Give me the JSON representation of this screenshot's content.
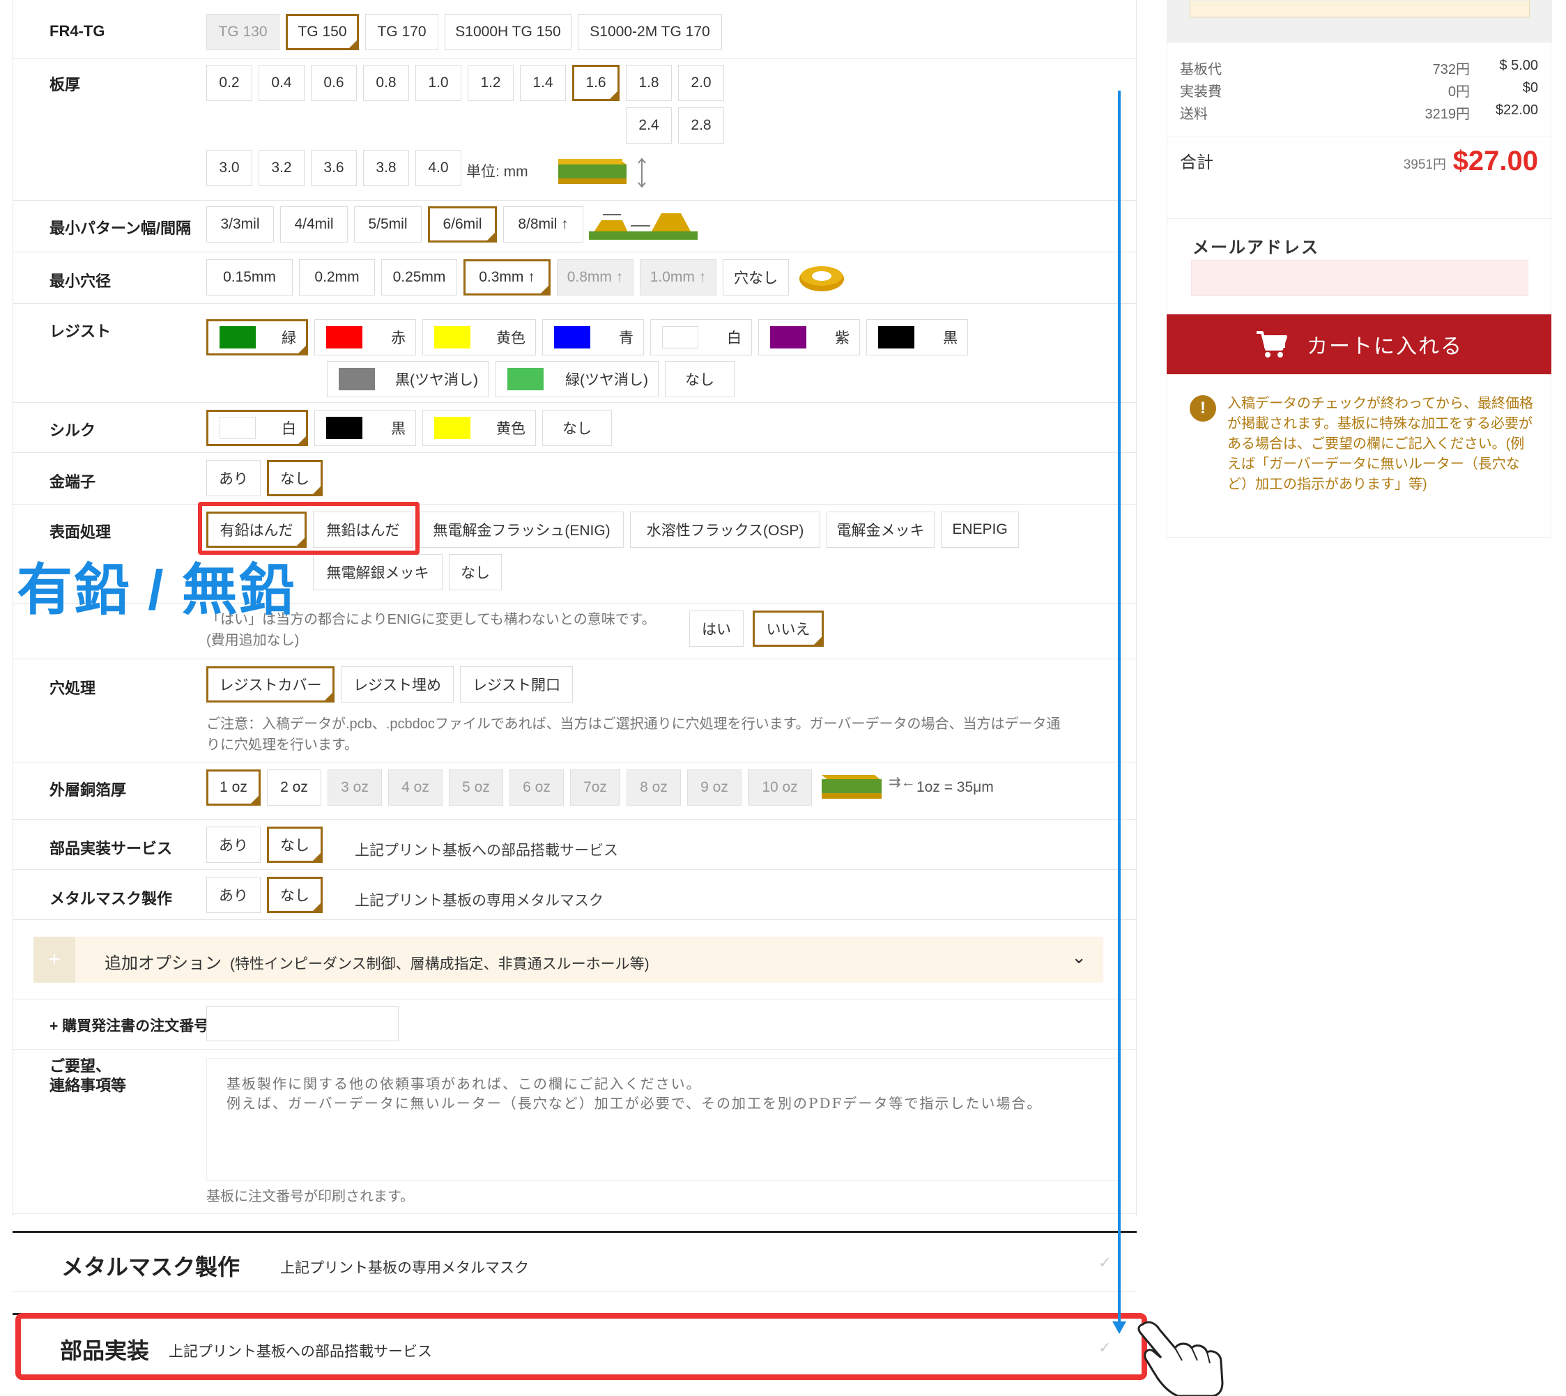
{
  "rows": {
    "fr4tg": {
      "label": "FR4-TG",
      "options": [
        "TG 130",
        "TG 150",
        "TG 170",
        "S1000H TG 150",
        "S1000-2M TG 170"
      ]
    },
    "thickness": {
      "label": "板厚",
      "options": [
        "0.2",
        "0.4",
        "0.6",
        "0.8",
        "1.0",
        "1.2",
        "1.4",
        "1.6",
        "1.8",
        "2.0",
        "2.4",
        "2.8",
        "3.0",
        "3.2",
        "3.6",
        "3.8",
        "4.0"
      ],
      "unit": "単位: mm"
    },
    "trace": {
      "label": "最小パターン幅/間隔",
      "options": [
        "3/3mil",
        "4/4mil",
        "5/5mil",
        "6/6mil",
        "8/8mil ↑"
      ]
    },
    "hole": {
      "label": "最小穴径",
      "options": [
        "0.15mm",
        "0.2mm",
        "0.25mm",
        "0.3mm ↑",
        "0.8mm ↑",
        "1.0mm ↑",
        "穴なし"
      ]
    },
    "resist": {
      "label": "レジスト",
      "options": [
        "緑",
        "赤",
        "黄色",
        "青",
        "白",
        "紫",
        "黒",
        "黒(ツヤ消し)",
        "緑(ツヤ消し)",
        "なし"
      ]
    },
    "silk": {
      "label": "シルク",
      "options": [
        "白",
        "黒",
        "黄色",
        "なし"
      ]
    },
    "gold": {
      "label": "金端子",
      "options": [
        "あり",
        "なし"
      ]
    },
    "surface": {
      "label": "表面処理",
      "options": [
        "有鉛はんだ",
        "無鉛はんだ",
        "無電解金フラッシュ(ENIG)",
        "水溶性フラックス(OSP)",
        "電解金メッキ",
        "ENEPIG",
        "無電解銀メッキ",
        "なし"
      ],
      "annotation": "有鉛 / 無鉛"
    },
    "enig": {
      "note_line1": "「はい」は当方の都合によりENIGに変更しても構わないとの意味です。",
      "note_line2": "(費用追加なし)",
      "options": [
        "はい",
        "いいえ"
      ]
    },
    "via": {
      "label": "穴処理",
      "options": [
        "レジストカバー",
        "レジスト埋め",
        "レジスト開口"
      ],
      "note_line1": "ご注意：入稿データが.pcb、.pcbdocファイルであれば、当方はご選択通りに穴処理を行います。ガーバーデータの場合、当方はデータ通",
      "note_line2": "りに穴処理を行います。"
    },
    "copper": {
      "label": "外層銅箔厚",
      "options": [
        "1 oz",
        "2 oz",
        "3 oz",
        "4 oz",
        "5 oz",
        "6 oz",
        "7oz",
        "8 oz",
        "9 oz",
        "10 oz"
      ],
      "arrow_text": "⇉←",
      "note": "1oz = 35μm"
    },
    "assembly": {
      "label": "部品実装サービス",
      "options": [
        "あり",
        "なし"
      ],
      "desc": "上記プリント基板への部品搭載サービス"
    },
    "stencil": {
      "label": "メタルマスク製作",
      "options": [
        "あり",
        "なし"
      ],
      "desc": "上記プリント基板の専用メタルマスク"
    },
    "extra": {
      "title": "追加オプション",
      "subtitle": "(特性インピーダンス制御、層構成指定、非貫通スルーホール等)",
      "plus": "+",
      "chevron": "⌄"
    },
    "po": {
      "label": "+ 購買発注書の注文番号",
      "value": ""
    },
    "request": {
      "label_line1": "ご要望、",
      "label_line2": "連絡事項等",
      "placeholder": "基板製作に関する他の依頼事項があれば、この欄にご記入ください。\n例えば、ガーバーデータに無いルーター（長穴など）加工が必要で、その加工を別のPDFデータ等で指示したい場合。",
      "note": "基板に注文番号が印刷されます。"
    }
  },
  "panels": {
    "stencil": {
      "title": "メタルマスク製作",
      "sub": "上記プリント基板の専用メタルマスク",
      "check": "✓"
    },
    "assembly": {
      "title": "部品実装",
      "sub": "上記プリント基板への部品搭載サービス",
      "check": "✓"
    }
  },
  "sidebar": {
    "lines": [
      {
        "label": "基板代",
        "yen": "732円",
        "usd": "$ 5.00"
      },
      {
        "label": "実装費",
        "yen": "0円",
        "usd": "$0"
      },
      {
        "label": "送料",
        "yen": "3219円",
        "usd": "$22.00"
      }
    ],
    "total_label": "合計",
    "total_yen": "3951円",
    "total_usd": "$27.00",
    "email_label": "メールアドレス",
    "email_value": "",
    "cart_button": "カートに入れる",
    "warning": "入稿データのチェックが終わってから、最終価格が掲載されます。基板に特殊な加工をする必要がある場合は、ご要望の欄にご記入ください。(例えば「ガーバーデータに無いルーター（長穴など）加工の指示があります」等)"
  },
  "colors": {
    "accent": "#9b6a12",
    "price_red": "#e52d27",
    "cart_red": "#b51b21",
    "highlight_red": "#ee3333",
    "annotation_blue": "#1a8be3",
    "resist_green": "#0a8a0a",
    "resist_red": "#ff0000",
    "resist_yellow": "#ffff00",
    "resist_blue": "#0000ff",
    "resist_purple": "#800080",
    "resist_black": "#000000",
    "resist_grey": "#808080",
    "resist_matte_green": "#4cc158"
  }
}
